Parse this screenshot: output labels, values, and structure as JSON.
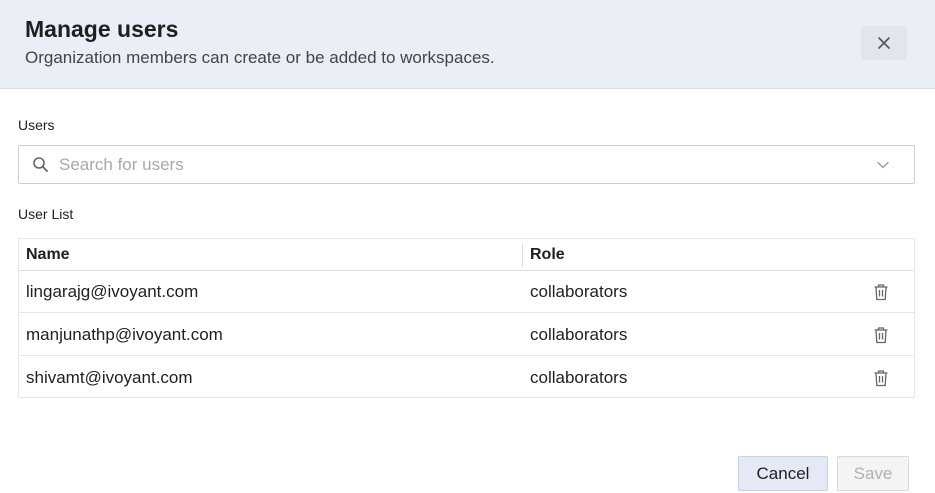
{
  "dialog": {
    "title": "Manage users",
    "subtitle": "Organization members can create or be added to workspaces.",
    "close_icon": "close-icon"
  },
  "users_section": {
    "label": "Users",
    "search_placeholder": "Search for users",
    "search_value": "",
    "search_icon": "search-icon",
    "dropdown_icon": "chevron-down-icon"
  },
  "user_list": {
    "label": "User List",
    "columns": [
      "Name",
      "Role"
    ],
    "rows": [
      {
        "name": "lingarajg@ivoyant.com",
        "role": "collaborators"
      },
      {
        "name": "manjunathp@ivoyant.com",
        "role": "collaborators"
      },
      {
        "name": "shivamt@ivoyant.com",
        "role": "collaborators"
      }
    ],
    "row_action_icon": "trash-icon"
  },
  "footer": {
    "cancel_label": "Cancel",
    "save_label": "Save"
  },
  "colors": {
    "header_bg": "#e9eef7",
    "cancel_bg": "#e4e9f5",
    "save_disabled_text": "#b0b0b0"
  }
}
